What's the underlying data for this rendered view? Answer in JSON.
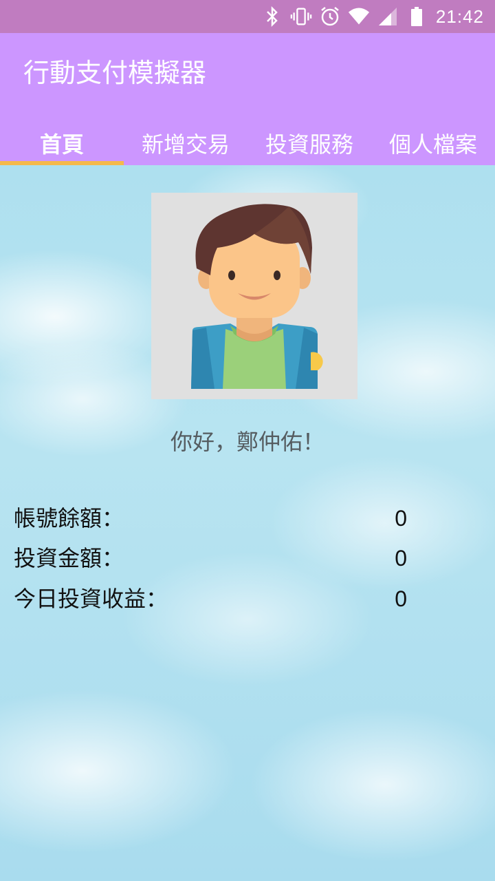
{
  "status_bar": {
    "time": "21:42",
    "icons": [
      "bluetooth-icon",
      "vibrate-icon",
      "alarm-icon",
      "wifi-icon",
      "signal-icon",
      "battery-icon"
    ]
  },
  "app_bar": {
    "title": "行動支付模擬器",
    "tabs": [
      {
        "label": "首頁",
        "active": true
      },
      {
        "label": "新增交易",
        "active": false
      },
      {
        "label": "投資服務",
        "active": false
      },
      {
        "label": "個人檔案",
        "active": false
      }
    ]
  },
  "home": {
    "avatar_icon": "user-avatar-icon",
    "greeting": "你好，鄭仲佑！",
    "rows": [
      {
        "label": "帳號餘額：",
        "value": "0"
      },
      {
        "label": "投資金額：",
        "value": "0"
      },
      {
        "label": "今日投資收益：",
        "value": "0"
      }
    ]
  },
  "colors": {
    "status_bar": "#c07cc0",
    "app_bar": "#cc96ff",
    "tab_indicator": "#f5b94a",
    "sky": "#aee0ef"
  }
}
